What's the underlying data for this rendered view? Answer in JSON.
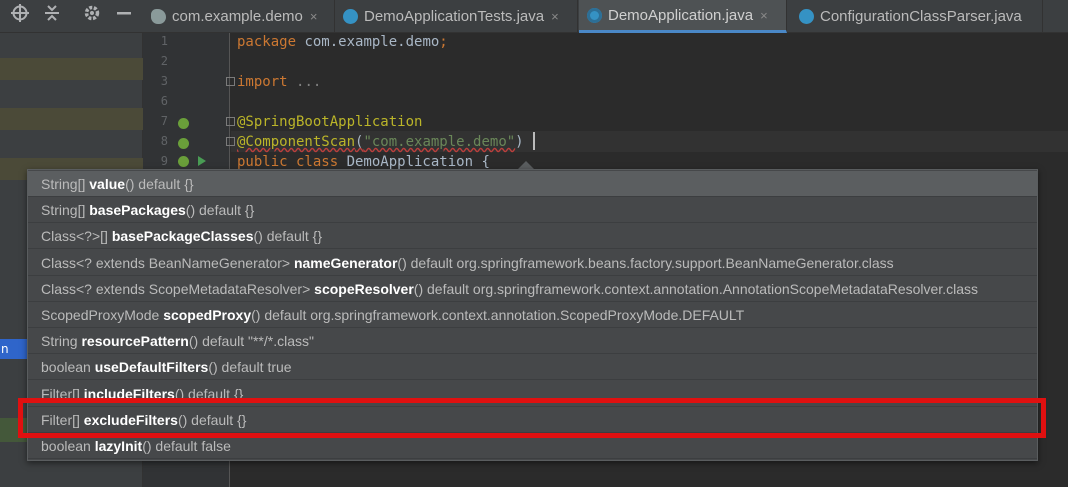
{
  "tabs": [
    {
      "label": "com.example.demo",
      "icon": "gradle-icon",
      "color": "#8a9a9a",
      "active": false
    },
    {
      "label": "DemoApplicationTests.java",
      "icon": "class-icon",
      "color": "#3592c4",
      "active": false
    },
    {
      "label": "DemoApplication.java",
      "icon": "spring-class-icon",
      "color": "#3592c4",
      "active": true
    },
    {
      "label": "ConfigurationClassParser.java",
      "icon": "class-icon",
      "color": "#3592c4",
      "active": false
    }
  ],
  "tab_close_glyph": "×",
  "left_panel": {
    "icons": [
      "crosshair-icon",
      "collapse-icon",
      "gear-icon",
      "minimize-icon"
    ],
    "selected_text": "n"
  },
  "editor": {
    "lines": [
      {
        "num": "1",
        "segments": [
          {
            "t": "package ",
            "c": "kw"
          },
          {
            "t": "com.example.demo",
            "c": ""
          },
          {
            "t": ";",
            "c": "kw"
          }
        ]
      },
      {
        "num": "2",
        "segments": []
      },
      {
        "num": "3",
        "segments": [
          {
            "t": "import ",
            "c": "kw"
          },
          {
            "t": "...",
            "c": "dim"
          }
        ]
      },
      {
        "num": "6",
        "segments": []
      },
      {
        "num": "7",
        "segments": [
          {
            "t": "@SpringBootApplication",
            "c": "ann"
          }
        ]
      },
      {
        "num": "8",
        "segments": [
          {
            "t": "@ComponentScan",
            "c": "ann err-underline"
          },
          {
            "t": "(",
            "c": "err-underline"
          },
          {
            "t": "\"com.example.demo\"",
            "c": "str err-underline"
          },
          {
            "t": ")",
            "c": ""
          }
        ]
      },
      {
        "num": "9",
        "segments": [
          {
            "t": "public class ",
            "c": "kw"
          },
          {
            "t": "DemoApplication {",
            "c": ""
          }
        ]
      }
    ]
  },
  "completion": {
    "items": [
      {
        "prefix": "String[] ",
        "name": "value",
        "suffix": "() default {}"
      },
      {
        "prefix": "String[] ",
        "name": "basePackages",
        "suffix": "() default {}"
      },
      {
        "prefix": "Class<?>[] ",
        "name": "basePackageClasses",
        "suffix": "() default {}"
      },
      {
        "prefix": "Class<? extends BeanNameGenerator> ",
        "name": "nameGenerator",
        "suffix": "() default org.springframework.beans.factory.support.BeanNameGenerator.class"
      },
      {
        "prefix": "Class<? extends ScopeMetadataResolver> ",
        "name": "scopeResolver",
        "suffix": "() default org.springframework.context.annotation.AnnotationScopeMetadataResolver.class"
      },
      {
        "prefix": "ScopedProxyMode ",
        "name": "scopedProxy",
        "suffix": "() default org.springframework.context.annotation.ScopedProxyMode.DEFAULT"
      },
      {
        "prefix": "String ",
        "name": "resourcePattern",
        "suffix": "() default \"**/*.class\""
      },
      {
        "prefix": "boolean ",
        "name": "useDefaultFilters",
        "suffix": "() default true"
      },
      {
        "prefix": "Filter[] ",
        "name": "includeFilters",
        "suffix": "() default {}"
      },
      {
        "prefix": "Filter[] ",
        "name": "excludeFilters",
        "suffix": "() default {}"
      },
      {
        "prefix": "boolean ",
        "name": "lazyInit",
        "suffix": "() default false"
      }
    ],
    "highlighted_index": 9,
    "highlight_color": "#e01010"
  }
}
